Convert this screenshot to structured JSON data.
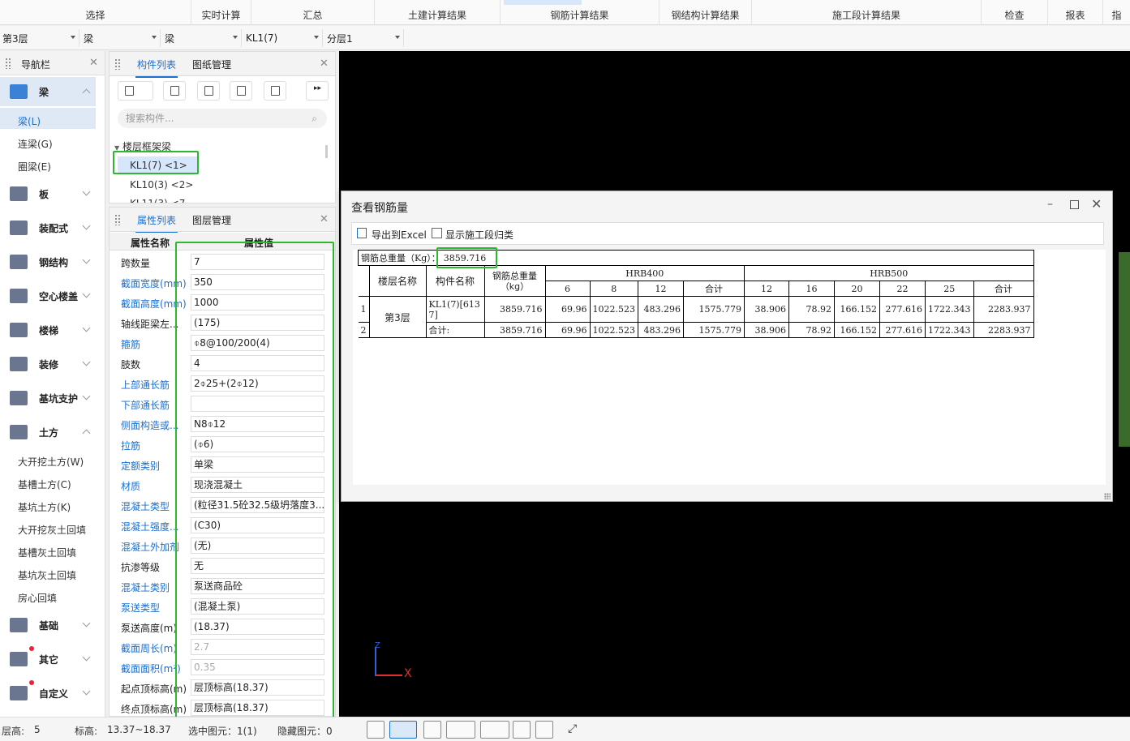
{
  "top_tabs": [
    "选择",
    "实时计算",
    "汇总",
    "土建计算结果",
    "钢筋计算结果",
    "钢结构计算结果",
    "施工段计算结果",
    "检查",
    "报表",
    "指"
  ],
  "selectors": [
    "第3层",
    "梁",
    "梁",
    "KL1(7)",
    "分层1"
  ],
  "nav": {
    "title": "导航栏",
    "categories": [
      "梁",
      "板",
      "装配式",
      "钢结构",
      "空心楼盖",
      "楼梯",
      "装修",
      "基坑支护",
      "土方",
      "基础",
      "其它",
      "自定义"
    ],
    "beam_items": [
      "梁(L)",
      "连梁(G)",
      "圈梁(E)"
    ],
    "earth_items": [
      "大开挖土方(W)",
      "基槽土方(C)",
      "基坑土方(K)",
      "大开挖灰土回填",
      "基槽灰土回填",
      "基坑灰土回填",
      "房心回填"
    ]
  },
  "component_panel": {
    "tab_active": "构件列表",
    "tab_other": "图纸管理",
    "search_placeholder": "搜索构件...",
    "group": "楼层框架梁",
    "items": [
      "KL1(7) <1>",
      "KL10(3) <2>",
      "KL11(3) <7"
    ]
  },
  "property_panel": {
    "tab_active": "属性列表",
    "tab_other": "图层管理",
    "col_name": "属性名称",
    "col_value": "属性值",
    "rows": [
      {
        "name": "跨数量",
        "value": "7"
      },
      {
        "name": "截面宽度(mm)",
        "value": "350"
      },
      {
        "name": "截面高度(mm)",
        "value": "1000"
      },
      {
        "name": "轴线距梁左...",
        "value": "(175)"
      },
      {
        "name": "箍筋",
        "value": "⌽8@100/200(4)"
      },
      {
        "name": "肢数",
        "value": "4"
      },
      {
        "name": "上部通长筋",
        "value": "2⌽25+(2⌽12)"
      },
      {
        "name": "下部通长筋",
        "value": ""
      },
      {
        "name": "侧面构造或...",
        "value": "N8⌽12"
      },
      {
        "name": "拉筋",
        "value": "(⌽6)"
      },
      {
        "name": "定额类别",
        "value": "单梁"
      },
      {
        "name": "材质",
        "value": "现浇混凝土"
      },
      {
        "name": "混凝土类型",
        "value": "(粒径31.5砼32.5级坍落度3..."
      },
      {
        "name": "混凝土强度...",
        "value": "(C30)"
      },
      {
        "name": "混凝土外加剂",
        "value": "(无)"
      },
      {
        "name": "抗渗等级",
        "value": "无"
      },
      {
        "name": "混凝土类别",
        "value": "泵送商品砼"
      },
      {
        "name": "泵送类型",
        "value": "(混凝土泵)"
      },
      {
        "name": "泵送高度(m)",
        "value": "(18.37)"
      },
      {
        "name": "截面周长(m)",
        "value": "2.7"
      },
      {
        "name": "截面面积(m²)",
        "value": "0.35"
      },
      {
        "name": "起点顶标高(m)",
        "value": "层顶标高(18.37)"
      },
      {
        "name": "终点顶标高(m)",
        "value": "层顶标高(18.37)"
      }
    ]
  },
  "dialog": {
    "title": "查看钢筋量",
    "export_label": "导出到Excel",
    "checkbox_label": "显示施工段归类",
    "total_label": "钢筋总重量（Kg）：",
    "total_value": "3859.716",
    "h_floor": "楼层名称",
    "h_comp": "构件名称",
    "h_total": "钢筋总重量（kg）",
    "h_hrb400": "HRB400",
    "h_hrb500": "HRB500",
    "d400": [
      "6",
      "8",
      "12",
      "合计"
    ],
    "d500": [
      "12",
      "16",
      "20",
      "22",
      "25",
      "合计"
    ],
    "floor": "第3层",
    "rows": [
      {
        "idx": "1",
        "comp": "KL1(7)[6137]",
        "total": "3859.716",
        "v": [
          "69.96",
          "1022.523",
          "483.296",
          "1575.779",
          "38.906",
          "78.92",
          "166.152",
          "277.616",
          "1722.343",
          "2283.937"
        ]
      },
      {
        "idx": "2",
        "comp": "合计:",
        "total": "3859.716",
        "v": [
          "69.96",
          "1022.523",
          "483.296",
          "1575.779",
          "38.906",
          "78.92",
          "166.152",
          "277.616",
          "1722.343",
          "2283.937"
        ]
      }
    ]
  },
  "status": {
    "floor_h_label": "层高:",
    "floor_h": "5",
    "elev_label": "标高:",
    "elev": "13.37~18.37",
    "selected": "选中图元：1(1)",
    "hidden": "隐藏图元：0"
  },
  "colors": {
    "accent": "#1a6fd1",
    "highlight": "#2db82d",
    "canvas": "#000000"
  }
}
